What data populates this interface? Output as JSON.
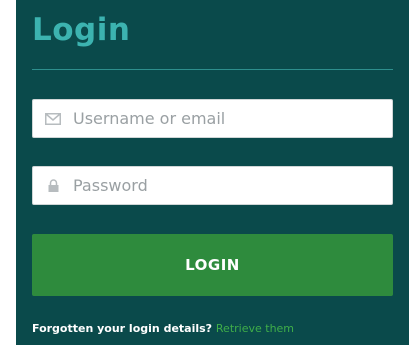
{
  "login": {
    "title": "Login",
    "username_placeholder": "Username or email",
    "password_placeholder": "Password",
    "submit_label": "LOGIN",
    "forgot_text": "Forgotten your login details?",
    "retrieve_link": "Retrieve them"
  },
  "colors": {
    "panel_bg": "#0a4a4b",
    "title": "#3cb3b0",
    "button_bg": "#2e8b3d",
    "link": "#3fae49"
  },
  "icons": {
    "username": "envelope-icon",
    "password": "lock-icon"
  }
}
